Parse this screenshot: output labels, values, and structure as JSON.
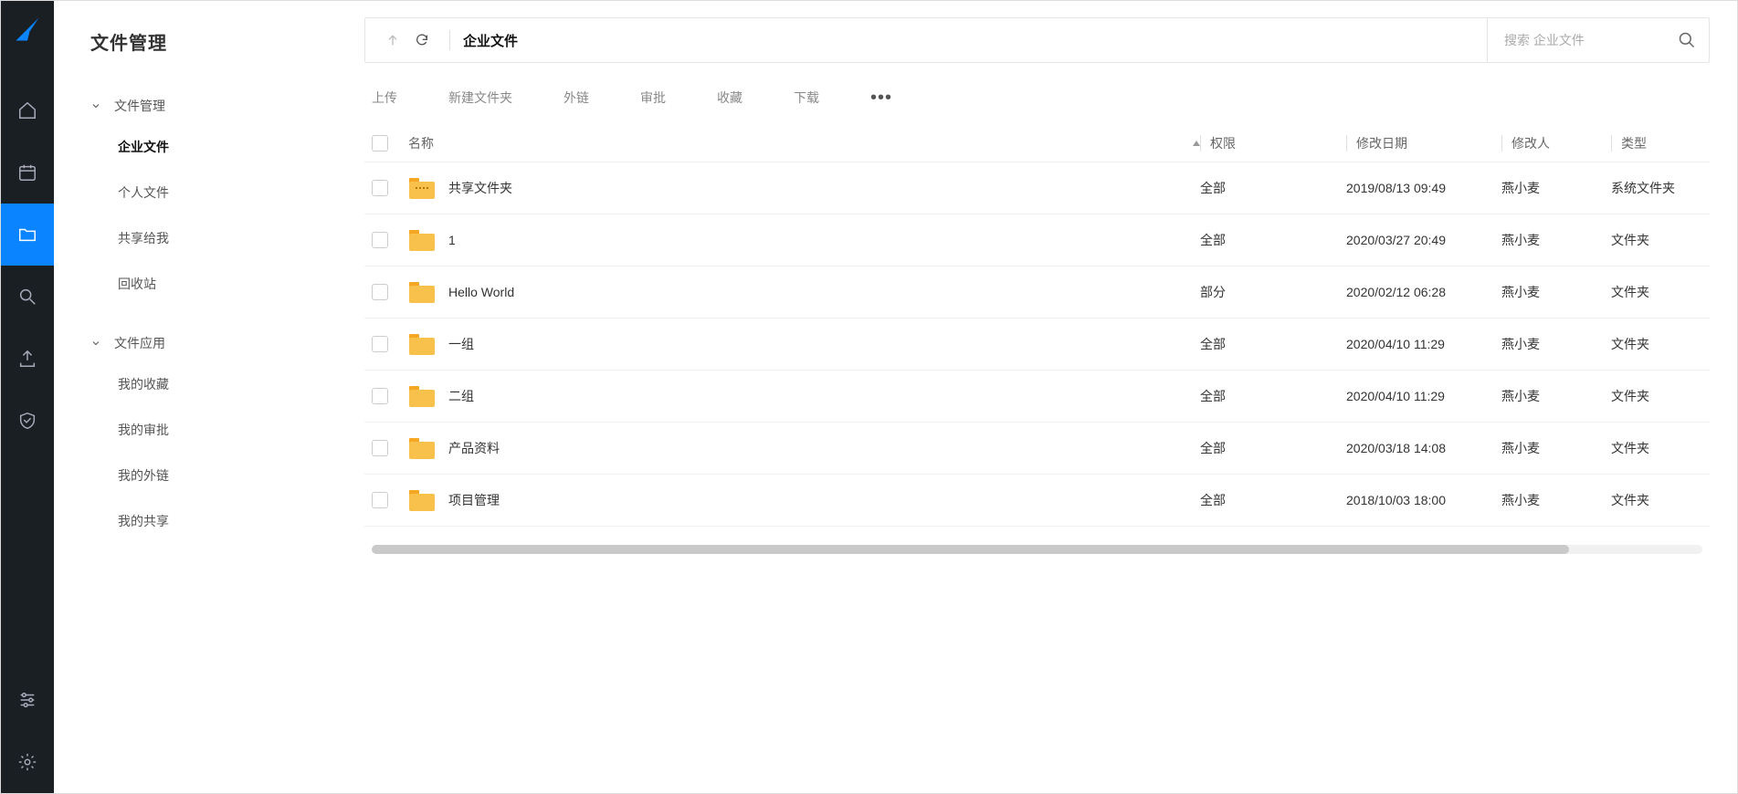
{
  "sidebar": {
    "title": "文件管理",
    "groups": [
      {
        "label": "文件管理",
        "children": [
          {
            "label": "企业文件",
            "active": true
          },
          {
            "label": "个人文件"
          },
          {
            "label": "共享给我"
          },
          {
            "label": "回收站"
          }
        ]
      },
      {
        "label": "文件应用",
        "children": [
          {
            "label": "我的收藏"
          },
          {
            "label": "我的审批"
          },
          {
            "label": "我的外链"
          },
          {
            "label": "我的共享"
          }
        ]
      }
    ]
  },
  "breadcrumb": "企业文件",
  "search_placeholder": "搜索 企业文件",
  "actions": {
    "upload": "上传",
    "new_folder": "新建文件夹",
    "external_link": "外链",
    "approval": "审批",
    "favorite": "收藏",
    "download": "下载"
  },
  "columns": {
    "name": "名称",
    "permission": "权限",
    "modified": "修改日期",
    "modifier": "修改人",
    "type": "类型"
  },
  "rows": [
    {
      "name": "共享文件夹",
      "permission": "全部",
      "modified": "2019/08/13 09:49",
      "modifier": "燕小麦",
      "type": "系统文件夹",
      "shared": true
    },
    {
      "name": "1",
      "permission": "全部",
      "modified": "2020/03/27 20:49",
      "modifier": "燕小麦",
      "type": "文件夹",
      "shared": false
    },
    {
      "name": "Hello World",
      "permission": "部分",
      "modified": "2020/02/12 06:28",
      "modifier": "燕小麦",
      "type": "文件夹",
      "shared": false
    },
    {
      "name": "一组",
      "permission": "全部",
      "modified": "2020/04/10 11:29",
      "modifier": "燕小麦",
      "type": "文件夹",
      "shared": false
    },
    {
      "name": "二组",
      "permission": "全部",
      "modified": "2020/04/10 11:29",
      "modifier": "燕小麦",
      "type": "文件夹",
      "shared": false
    },
    {
      "name": "产品资料",
      "permission": "全部",
      "modified": "2020/03/18 14:08",
      "modifier": "燕小麦",
      "type": "文件夹",
      "shared": false
    },
    {
      "name": "项目管理",
      "permission": "全部",
      "modified": "2018/10/03 18:00",
      "modifier": "燕小麦",
      "type": "文件夹",
      "shared": false
    }
  ]
}
